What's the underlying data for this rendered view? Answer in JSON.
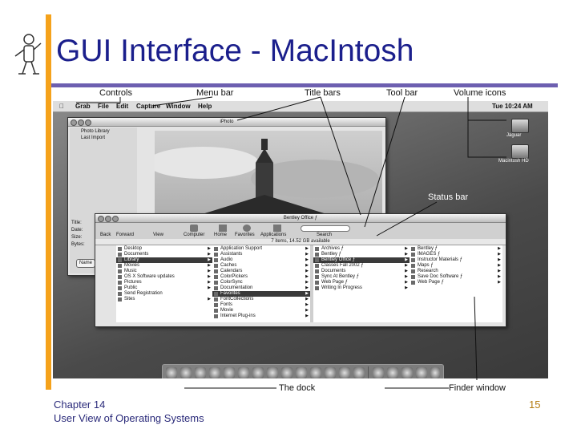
{
  "slide": {
    "title": "GUI Interface - MacIntosh",
    "footer_line1": "Chapter 14",
    "footer_line2": "User View of Operating Systems",
    "page_number": "15"
  },
  "colors": {
    "title": "#1b1f8c",
    "accent_bar": "#f5a21b",
    "rule": "#6d5fb0"
  },
  "callouts": {
    "controls": "Controls",
    "menu_bar": "Menu bar",
    "title_bars": "Title bars",
    "tool_bar": "Tool bar",
    "volume_icons": "Volume icons",
    "status_bar": "Status bar",
    "the_dock": "The dock",
    "finder_window": "Finder window"
  },
  "menubar": {
    "apple": "",
    "items": [
      "Grab",
      "File",
      "Edit",
      "Capture",
      "Window",
      "Help"
    ],
    "clock": "Tue 10:24 AM"
  },
  "volumes": [
    "Jaguar",
    "Macintosh HD"
  ],
  "iphoto": {
    "title": "iPhoto",
    "sidebar": [
      "Photo Library",
      "Last Import"
    ],
    "info_labels": [
      "Title:",
      "Date:",
      "Size:",
      "Bytes:"
    ],
    "name_button": "Name"
  },
  "finder": {
    "title": "Bentley Office ƒ",
    "toolbar": [
      "Back",
      "Forward",
      "View",
      "Computer",
      "Home",
      "Favorites",
      "Applications",
      "Search"
    ],
    "status": "7 items, 14.52 GB available",
    "col1": [
      "Desktop",
      "Documents",
      "Library",
      "Movies",
      "Music",
      "OS X Software updates",
      "Pictures",
      "Public",
      "Send Registration",
      "Sites"
    ],
    "col2": [
      "Application Support",
      "Assistants",
      "Audio",
      "Caches",
      "Calendars",
      "ColorPickers",
      "ColorSync",
      "Documentation",
      "Favorites",
      "FontCollections",
      "Fonts",
      "Movie",
      "Internet Plug-ins"
    ],
    "col3": [
      "Archives ƒ",
      "Bentley ƒ",
      "Bentley Office ƒ",
      "Classes Fall 2002 ƒ",
      "Documents",
      "Sync At Bentley ƒ",
      "Web Page ƒ",
      "Writing In Progress"
    ],
    "col4": [
      "Bentley ƒ",
      "IMAGES ƒ",
      "Instructor Materials ƒ",
      "Maps ƒ",
      "Research",
      "Save Doc Software ƒ",
      "Web Page ƒ"
    ]
  }
}
